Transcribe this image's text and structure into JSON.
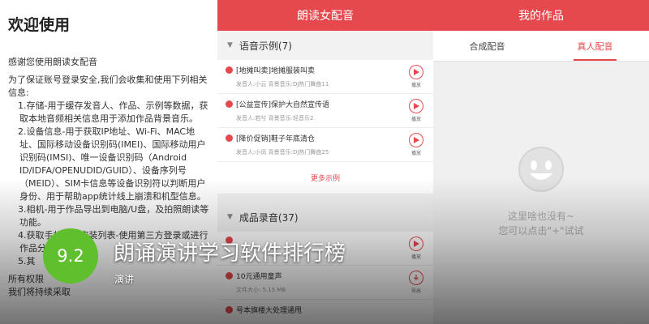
{
  "privacy": {
    "title": "欢迎使用",
    "intro": "感谢您使用朗读女配音",
    "lead": "为了保证账号登录安全,我们会收集和使用下列相关信息:",
    "items": [
      "1.存储-用于缓存发音人、作品、示例等数据，获取本地音频相关信息用于添加作品背景音乐。",
      "2.设备信息-用于获取IP地址、Wi-Fi、MAC地址、国际移动设备识别码(IMEI)、国际移动用户识别码(IMSI)、唯一设备识别码（Android ID/IDFA/OPENUDID/GUID）、设备序列号（MEID）、SIM卡信息等设备识别符以判断用户身份、用于帮助app统计线上崩溃和机型信息。",
      "3.相机-用于作品导出到电脑/U盘，及拍照朗读等功能。",
      "4.获取手机软件安装列表-使用第三方登录或进行作品分享，",
      "5.其"
    ],
    "closing_1": "所有权限",
    "closing_2": "我们将持续采取"
  },
  "recordings": {
    "header_title": "朗读女配音",
    "examples_section": "语音示例(7)",
    "examples": [
      {
        "title": "[地摊叫卖]地摊服装叫卖",
        "meta": "发音人:小云   背景音乐:DJ热门舞曲11",
        "action": "播放"
      },
      {
        "title": "[公益宣传]保护大自然宣传语",
        "meta": "发音人:若兮   背景音乐:轻音乐2",
        "action": "播放"
      },
      {
        "title": "[降价促销]鞋子年底清仓",
        "meta": "发音人:小凤   背景音乐:DJ热门舞曲25",
        "action": "播放"
      }
    ],
    "more_label": "更多示例",
    "finished_section": "成品录音(37)",
    "finished": [
      {
        "title": "",
        "meta": "",
        "action": "播放"
      },
      {
        "title": "10元通用童声",
        "meta": "文件大小: 5.15 MB",
        "action": "导出"
      },
      {
        "title": "号本旗楼大处理通甩",
        "meta": "",
        "action": ""
      }
    ]
  },
  "works": {
    "header_title": "我的作品",
    "tabs": [
      "合成配音",
      "真人配音"
    ],
    "active_tab": 1,
    "empty_line_1": "这里啥也没有~",
    "empty_line_2": "您可以点击\"+\"试试"
  },
  "overlay": {
    "score": "9.2",
    "headline": "朗诵演讲学习软件排行榜",
    "tag": "演讲"
  },
  "colors": {
    "brand_red": "#e5484d",
    "score_green": "#5fbf2c"
  }
}
